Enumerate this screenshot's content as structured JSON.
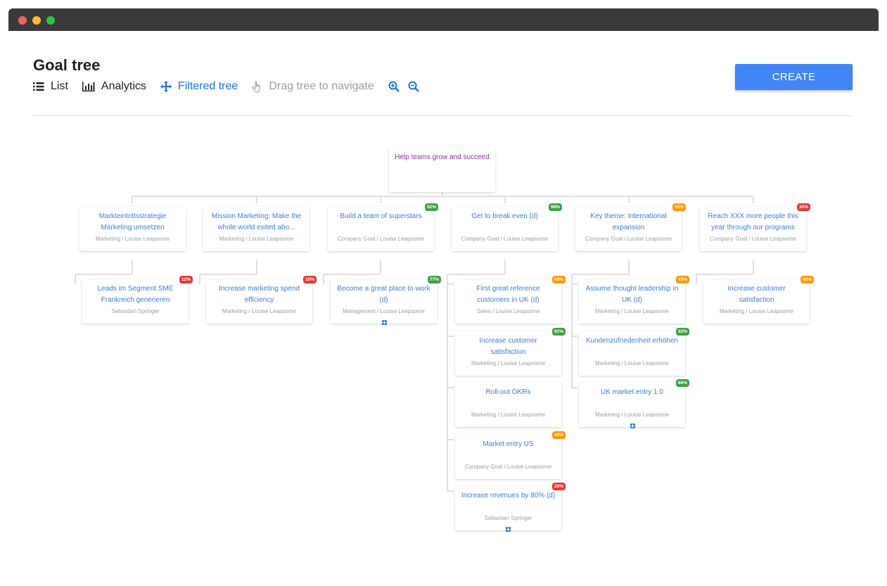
{
  "page": {
    "title": "Goal tree"
  },
  "toolbar": {
    "list_label": "List",
    "analytics_label": "Analytics",
    "filtered_tree_label": "Filtered tree",
    "drag_hint": "Drag tree to navigate",
    "create_label": "CREATE"
  },
  "colors": {
    "accent": "#4285f4",
    "link": "#3f7ddb",
    "root": "#9c27b0",
    "green": "#43a047",
    "orange": "#ff9800",
    "red": "#e53935"
  },
  "tree": {
    "root": {
      "title": "Help teams grow and succeed",
      "owner": ""
    },
    "level1": [
      {
        "title": "Markteintrittsstrategie Marketing umsetzen",
        "owner": "Marketing / Louise Leapsome",
        "progress": ""
      },
      {
        "title": "Mission Marketing: Make the whole world exited abo...",
        "owner": "Marketing / Louise Leapsome",
        "progress": ""
      },
      {
        "title": "Build a team of superstars",
        "owner": "Company Goal / Louise Leapsome",
        "progress": "92%"
      },
      {
        "title": "Get to break even (d)",
        "owner": "Company Goal / Louise Leapsome",
        "progress": "98%"
      },
      {
        "title": "Key theme: International expansion",
        "owner": "Company Goal / Louise Leapsome",
        "progress": "55%"
      },
      {
        "title": "Reach XXX more people this year through our programs",
        "owner": "Company Goal / Louise Leapsome",
        "progress": "30%"
      }
    ],
    "level2": [
      {
        "title": "Leads im Segment SME Frankreich generieren",
        "owner": "Sebastian Springer",
        "progress": "12%"
      },
      {
        "title": "Increase marketing spend efficiency",
        "owner": "Marketing / Louise Leapsome",
        "progress": "10%"
      },
      {
        "title": "Become a great place to work (d)",
        "owner": "Management / Louise Leapsome",
        "progress": "77%"
      },
      {
        "title": "First great reference customers in UK (d)",
        "owner": "Sales / Louise Leapsome",
        "progress": "66%"
      },
      {
        "title": "Increase customer satisfaction",
        "owner": "Marketing / Louise Leapsome",
        "progress": "92%"
      },
      {
        "title": "Roll-out OKRs",
        "owner": "Marketing / Louise Leapsome",
        "progress": ""
      },
      {
        "title": "Market entry US",
        "owner": "Company Goal / Louise Leapsome",
        "progress": "40%"
      },
      {
        "title": "Increase revenues by 80% (d)",
        "owner": "Sebastian Springer",
        "progress": "20%"
      },
      {
        "title": "Assume thought leadership in UK (d)",
        "owner": "Marketing / Louise Leapsome",
        "progress": "45%"
      },
      {
        "title": "Kundenzufriedenheit erhöhen",
        "owner": "Marketing / Louise Leapsome",
        "progress": "92%"
      },
      {
        "title": "UK market entry 1.0",
        "owner": "Marketing / Louise Leapsome",
        "progress": "86%"
      },
      {
        "title": "Increase customer satisfaction",
        "owner": "Marketing / Louise Leapsome",
        "progress": "50%"
      }
    ]
  }
}
